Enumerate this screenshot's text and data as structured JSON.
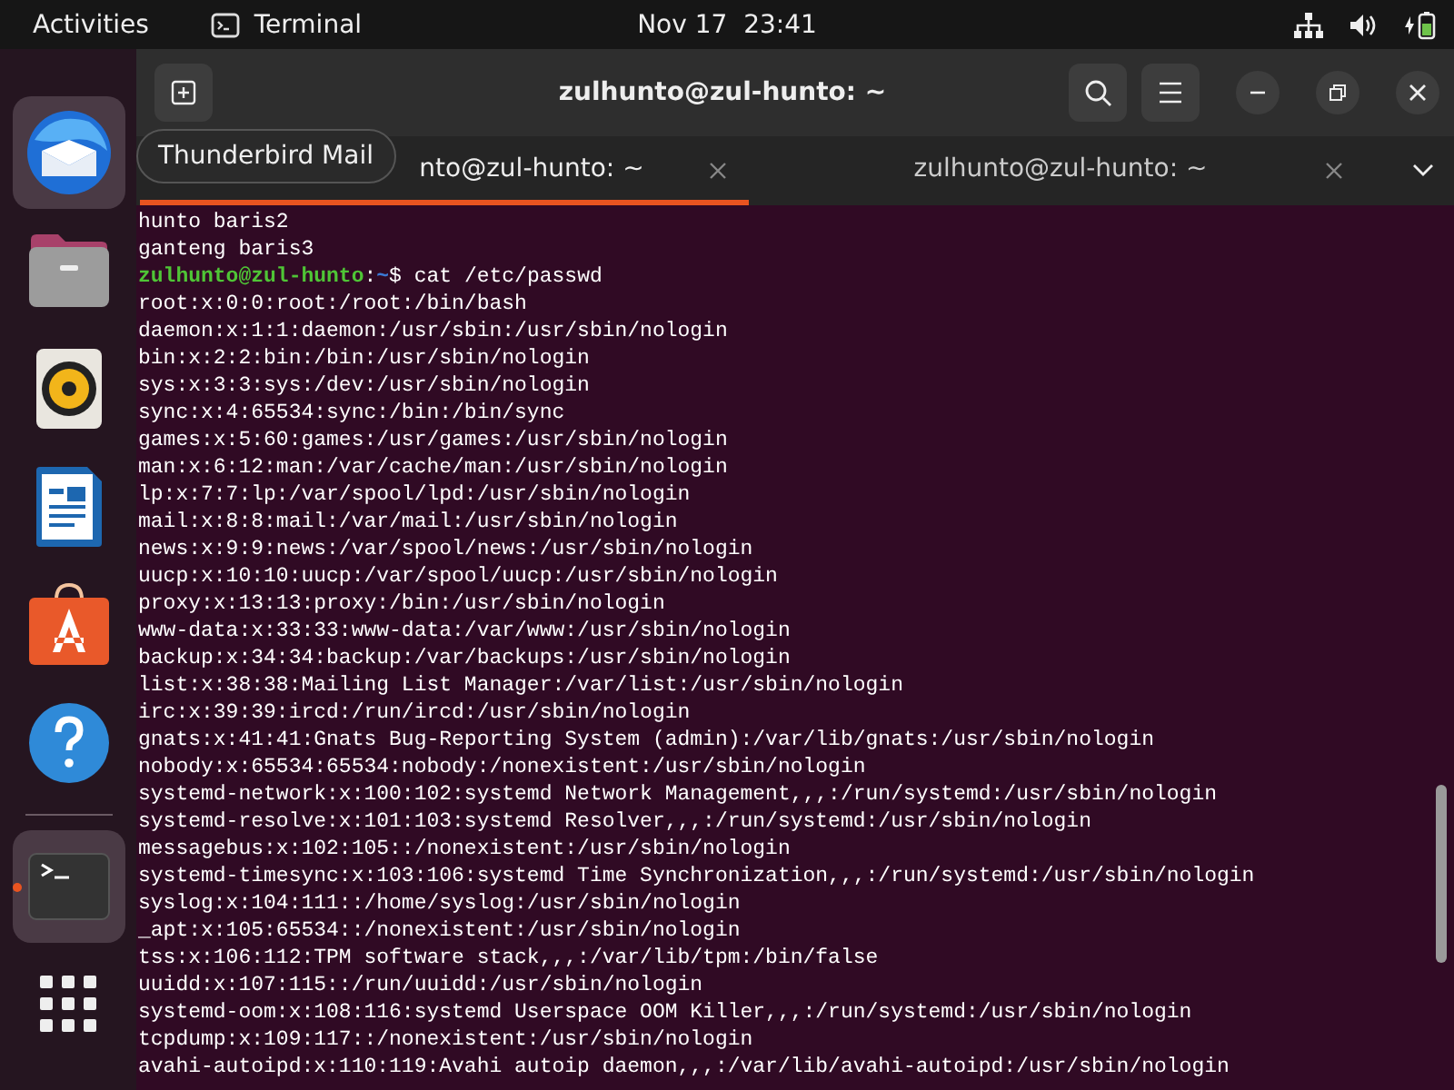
{
  "top_bar": {
    "activities": "Activities",
    "app_name": "Terminal",
    "clock": "Nov 17  23:41"
  },
  "dock": {
    "items": [
      {
        "kind": "thunderbird",
        "highlighted": true,
        "running": false
      },
      {
        "kind": "files",
        "highlighted": false,
        "running": false
      },
      {
        "kind": "rhythmbox",
        "highlighted": false,
        "running": false
      },
      {
        "kind": "writer",
        "highlighted": false,
        "running": false
      },
      {
        "kind": "appcenter",
        "highlighted": false,
        "running": false
      },
      {
        "kind": "help",
        "highlighted": false,
        "running": false
      },
      {
        "kind": "separator"
      },
      {
        "kind": "terminal",
        "highlighted": true,
        "running": true
      },
      {
        "kind": "apps",
        "highlighted": false,
        "running": false
      }
    ],
    "tooltip": "Thunderbird Mail"
  },
  "window": {
    "title": "zulhunto@zul-hunto: ~",
    "tabs": [
      {
        "label": "nto@zul-hunto: ~",
        "selected": true
      },
      {
        "label": "zulhunto@zul-hunto: ~",
        "selected": false
      }
    ],
    "lines": [
      {
        "kind": "output",
        "text": "hunto baris2"
      },
      {
        "kind": "output",
        "text": "ganteng baris3"
      },
      {
        "kind": "prompt",
        "user_host": "zulhunto@zul-hunto",
        "separator": ":",
        "path": "~",
        "command": "$ cat /etc/passwd"
      },
      {
        "kind": "output",
        "text": "root:x:0:0:root:/root:/bin/bash"
      },
      {
        "kind": "output",
        "text": "daemon:x:1:1:daemon:/usr/sbin:/usr/sbin/nologin"
      },
      {
        "kind": "output",
        "text": "bin:x:2:2:bin:/bin:/usr/sbin/nologin"
      },
      {
        "kind": "output",
        "text": "sys:x:3:3:sys:/dev:/usr/sbin/nologin"
      },
      {
        "kind": "output",
        "text": "sync:x:4:65534:sync:/bin:/bin/sync"
      },
      {
        "kind": "output",
        "text": "games:x:5:60:games:/usr/games:/usr/sbin/nologin"
      },
      {
        "kind": "output",
        "text": "man:x:6:12:man:/var/cache/man:/usr/sbin/nologin"
      },
      {
        "kind": "output",
        "text": "lp:x:7:7:lp:/var/spool/lpd:/usr/sbin/nologin"
      },
      {
        "kind": "output",
        "text": "mail:x:8:8:mail:/var/mail:/usr/sbin/nologin"
      },
      {
        "kind": "output",
        "text": "news:x:9:9:news:/var/spool/news:/usr/sbin/nologin"
      },
      {
        "kind": "output",
        "text": "uucp:x:10:10:uucp:/var/spool/uucp:/usr/sbin/nologin"
      },
      {
        "kind": "output",
        "text": "proxy:x:13:13:proxy:/bin:/usr/sbin/nologin"
      },
      {
        "kind": "output",
        "text": "www-data:x:33:33:www-data:/var/www:/usr/sbin/nologin"
      },
      {
        "kind": "output",
        "text": "backup:x:34:34:backup:/var/backups:/usr/sbin/nologin"
      },
      {
        "kind": "output",
        "text": "list:x:38:38:Mailing List Manager:/var/list:/usr/sbin/nologin"
      },
      {
        "kind": "output",
        "text": "irc:x:39:39:ircd:/run/ircd:/usr/sbin/nologin"
      },
      {
        "kind": "output",
        "text": "gnats:x:41:41:Gnats Bug-Reporting System (admin):/var/lib/gnats:/usr/sbin/nologin"
      },
      {
        "kind": "output",
        "text": "nobody:x:65534:65534:nobody:/nonexistent:/usr/sbin/nologin"
      },
      {
        "kind": "output",
        "text": "systemd-network:x:100:102:systemd Network Management,,,:/run/systemd:/usr/sbin/nologin"
      },
      {
        "kind": "output",
        "text": "systemd-resolve:x:101:103:systemd Resolver,,,:/run/systemd:/usr/sbin/nologin"
      },
      {
        "kind": "output",
        "text": "messagebus:x:102:105::/nonexistent:/usr/sbin/nologin"
      },
      {
        "kind": "output",
        "text": "systemd-timesync:x:103:106:systemd Time Synchronization,,,:/run/systemd:/usr/sbin/nologin"
      },
      {
        "kind": "output",
        "text": "syslog:x:104:111::/home/syslog:/usr/sbin/nologin"
      },
      {
        "kind": "output",
        "text": "_apt:x:105:65534::/nonexistent:/usr/sbin/nologin"
      },
      {
        "kind": "output",
        "text": "tss:x:106:112:TPM software stack,,,:/var/lib/tpm:/bin/false"
      },
      {
        "kind": "output",
        "text": "uuidd:x:107:115::/run/uuidd:/usr/sbin/nologin"
      },
      {
        "kind": "output",
        "text": "systemd-oom:x:108:116:systemd Userspace OOM Killer,,,:/run/systemd:/usr/sbin/nologin"
      },
      {
        "kind": "output",
        "text": "tcpdump:x:109:117::/nonexistent:/usr/sbin/nologin"
      },
      {
        "kind": "output",
        "text": "avahi-autoipd:x:110:119:Avahi autoip daemon,,,:/var/lib/avahi-autoipd:/usr/sbin/nologin"
      }
    ]
  }
}
